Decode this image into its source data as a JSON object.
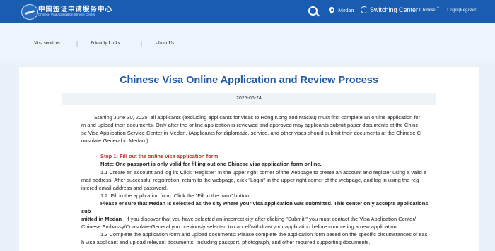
{
  "header": {
    "logo_cn": "中国签证申请服务中心",
    "logo_en": "Chinese Visa Application Service Center",
    "city": "Medan",
    "switch_label": "Switching Center",
    "language": "Chinese",
    "login_register": "Login|Register",
    "icons": [
      "search-icon",
      "location-pin-icon",
      "switch-icon",
      "chevron-down-icon",
      "emblem-logo"
    ]
  },
  "nav": {
    "items": [
      "Visa services",
      "Friendly Links",
      "about Us"
    ]
  },
  "article": {
    "title": "Chinese Visa Online Application and Review Process",
    "date": "2025-06-24",
    "intro": [
      "Starting June 30, 2025, all applicants (excluding applicants for visas to Hong Kong and Macau) must first complete an online application for",
      "m and upload their documents. Only after the online application is reviewed and approved may applicants submit paper documents at the Chine",
      "se Visa Application Service Center in Medan. (Applicants for diplomatic, service, and other visas should submit their documents at the Chinese C",
      "onsulate General in Medan.)"
    ],
    "step1_heading": "Step 1: Fill out the online visa application form",
    "note": "Note: One passport is only valid for filling out one Chinese visa application form online.",
    "s11": [
      "1.1 Create an account and log in: Click \"Register\" in the upper right corner of the webpage to create an account and register using a valid e",
      "mail address. After successful registration, return to the webpage, click \"Login\" in the upper right corner of the webpage, and log in using the reg",
      "istered email address and password."
    ],
    "s12": "1.2. Fill in the application form: Click the \"Fill in the form\" button.",
    "ensure_1": "Please ensure that Medan is selected as the city where your visa application was submitted. This center only accepts applications sub",
    "ensure_2_bold": "mitted in Medan",
    "ensure_2_rest": " . If you discover that you have selected an incorrect city after clicking \"Submit,\" you must contact the Visa Application Center/",
    "ensure_3": "Chinese Embassy/Consulate-General you previously selected to cancel/withdraw your application before completing a new application.",
    "s13": [
      "1.3 Complete the application form and upload documents: Please complete the application form based on the specific circumstances of eac",
      "h visa applicant and upload relevant documents, including passport, photograph, and other required supporting documents."
    ]
  }
}
